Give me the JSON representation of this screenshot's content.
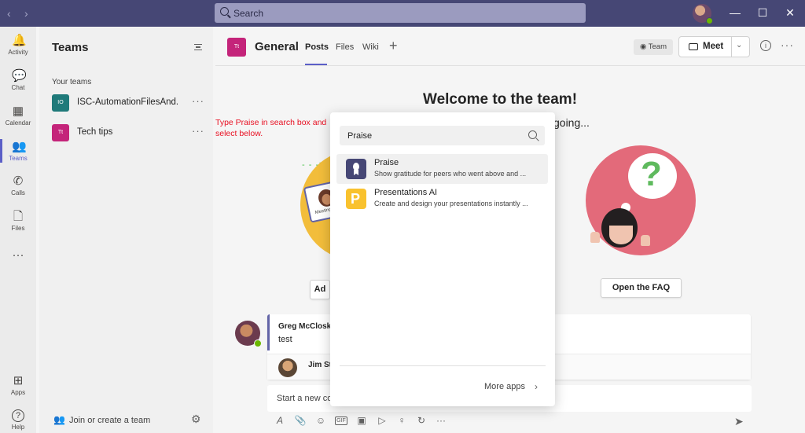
{
  "titlebar": {
    "search_placeholder": "Search",
    "back": "‹",
    "forward": "›",
    "minimize": "—",
    "maximize": "☐",
    "close": "✕"
  },
  "rail": {
    "items": [
      {
        "label": "Activity",
        "icon": "bell-icon",
        "glyph": "🔔"
      },
      {
        "label": "Chat",
        "icon": "chat-icon",
        "glyph": "💬"
      },
      {
        "label": "Calendar",
        "icon": "calendar-icon",
        "glyph": "▦"
      },
      {
        "label": "Teams",
        "icon": "teams-icon",
        "glyph": "👥"
      },
      {
        "label": "Calls",
        "icon": "phone-icon",
        "glyph": "✆"
      },
      {
        "label": "Files",
        "icon": "file-icon",
        "glyph": "🗋"
      },
      {
        "label": "",
        "icon": "more-icon",
        "glyph": "···"
      },
      {
        "label": "Apps",
        "icon": "apps-icon",
        "glyph": "⊞"
      },
      {
        "label": "Help",
        "icon": "help-icon",
        "glyph": "?"
      }
    ]
  },
  "teams_panel": {
    "title": "Teams",
    "section_label": "Your teams",
    "teams": [
      {
        "initials": "IO",
        "name": "ISC-AutomationFilesAnd...",
        "color": "#1f7a7a",
        "more": "···"
      },
      {
        "initials": "Tt",
        "name": "Tech tips",
        "color": "#c4247a",
        "more": "···"
      }
    ],
    "join_label": "Join or create a team",
    "settings_glyph": "⚙"
  },
  "channel": {
    "initials": "Tt",
    "name": "General",
    "tabs": [
      "Posts",
      "Files",
      "Wiki"
    ],
    "add_tab": "+",
    "team_label": "Team",
    "meet_label": "Meet",
    "info_glyph": "i",
    "more_glyph": "···"
  },
  "welcome": {
    "title": "Welcome to the team!",
    "subtitle": "going...",
    "left_button": "Ad",
    "right_button": "Open the FAQ",
    "card_caption": "Meeting"
  },
  "annotation": {
    "text": "Type Praise in search box and select below.",
    "arrow": "- - ->"
  },
  "post": {
    "author": "Greg McCloske",
    "message": "test",
    "reply_author": "Jim Str"
  },
  "compose": {
    "placeholder": "Start a new co",
    "send_glyph": "➤",
    "tools": [
      "A",
      "📎",
      "☺",
      "GIF",
      "▣",
      "▷",
      "♀",
      "↻",
      "···"
    ]
  },
  "popup": {
    "search_value": "Praise",
    "apps": [
      {
        "name": "Praise",
        "desc": "Show gratitude for peers who went above and ..."
      },
      {
        "name": "Presentations AI",
        "desc": "Create and design your presentations instantly ..."
      }
    ],
    "more_apps": "More apps",
    "chevron": "›"
  }
}
